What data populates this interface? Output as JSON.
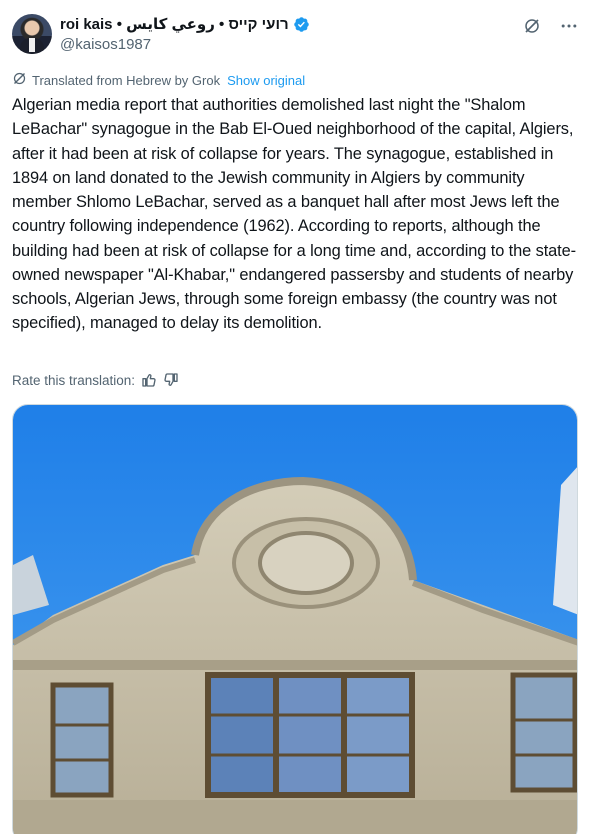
{
  "author": {
    "display_name": "roi kais • רועי קייס • روعي كايس",
    "handle": "@kaisos1987",
    "verified": true,
    "avatar": "avatar"
  },
  "header_actions": [
    {
      "icon": "grok-icon"
    },
    {
      "icon": "more-icon"
    }
  ],
  "translation": {
    "icon": "grok-icon",
    "label": "Translated from Hebrew by Grok",
    "show_original": "Show original"
  },
  "tweet": {
    "text": "Algerian media report that authorities demolished last night the \"Shalom LeBachar\" synagogue in the Bab El-Oued neighborhood of the capital, Algiers, after it had been at risk of collapse for years. The synagogue, established in 1894 on land donated to the Jewish community in Algiers by community member Shlomo LeBachar, served as a banquet hall after most Jews left the country following independence (1962). According to reports, although the building had been at risk of collapse for a long time and, according to the state-owned newspaper \"Al-Khabar,\" endangered passersby and students of nearby schools, Algerian Jews, through some foreign embassy (the country was not specified), managed to delay its demolition."
  },
  "rate_translation": {
    "label": "Rate this translation:",
    "icons": [
      "thumbs-up-icon",
      "thumbs-down-icon"
    ]
  },
  "media": {
    "type": "photo",
    "colors": {
      "sky": "#1e7fe6",
      "wall": "#c9c2ad",
      "frame": "#6b5a3e"
    }
  },
  "colors": {
    "link": "#1d9bf0",
    "muted": "#536471",
    "verified": "#1d9bf0"
  }
}
